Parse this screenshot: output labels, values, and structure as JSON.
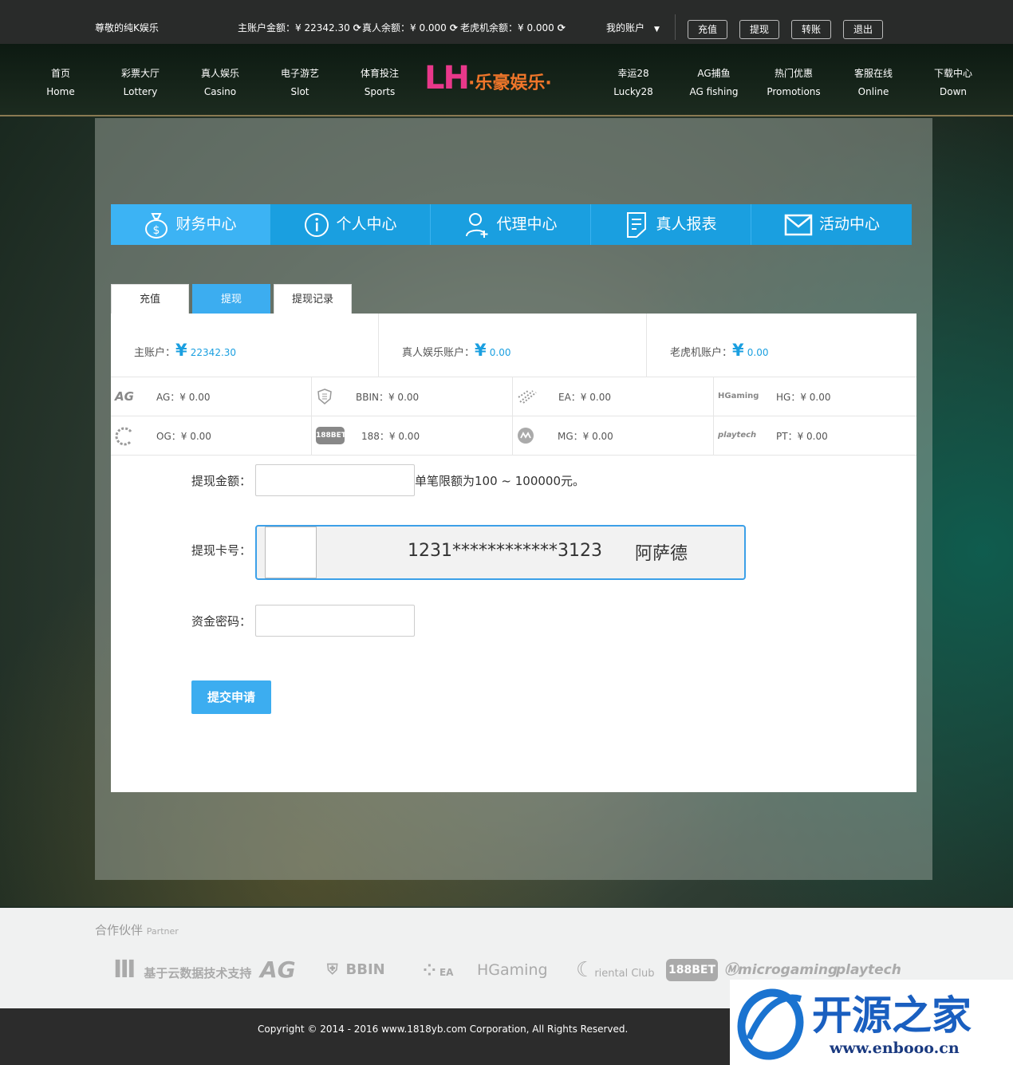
{
  "topbar": {
    "greeting": "尊敬的纯K娱乐",
    "main_balance": "主账户金额：¥ 22342.30",
    "live_balance": "真人余额：¥ 0.000",
    "slot_balance": "老虎机余额：¥ 0.000",
    "my_account": "我的账户",
    "buttons": [
      "充值",
      "提现",
      "转账",
      "退出"
    ]
  },
  "nav": {
    "left": [
      {
        "cn": "首页",
        "en": "Home"
      },
      {
        "cn": "彩票大厅",
        "en": "Lottery"
      },
      {
        "cn": "真人娱乐",
        "en": "Casino"
      },
      {
        "cn": "电子游艺",
        "en": "Slot"
      },
      {
        "cn": "体育投注",
        "en": "Sports"
      }
    ],
    "right": [
      {
        "cn": "幸运28",
        "en": "Lucky28"
      },
      {
        "cn": "AG捕鱼",
        "en": "AG fishing"
      },
      {
        "cn": "热门优惠",
        "en": "Promotions"
      },
      {
        "cn": "客服在线",
        "en": "Online"
      },
      {
        "cn": "下载中心",
        "en": "Down"
      }
    ],
    "logo_letters": "LH",
    "logo_text": "·乐豪娱乐·"
  },
  "center_tabs": [
    "财务中心",
    "个人中心",
    "代理中心",
    "真人报表",
    "活动中心"
  ],
  "sub_tabs": [
    "充值",
    "提现",
    "提现记录"
  ],
  "accounts": [
    {
      "label": "主账户：",
      "amount": "22342.30"
    },
    {
      "label": "真人娱乐账户：",
      "amount": "0.00"
    },
    {
      "label": "老虎机账户：",
      "amount": "0.00"
    }
  ],
  "yen_symbol": "¥",
  "games": [
    {
      "logo": "AG",
      "text": "AG：¥ 0.00"
    },
    {
      "logo": "",
      "text": "BBIN：¥ 0.00"
    },
    {
      "logo": "",
      "text": "EA：¥ 0.00"
    },
    {
      "logo": "HGaming",
      "text": "HG：¥ 0.00"
    },
    {
      "logo": "",
      "text": "OG：¥ 0.00"
    },
    {
      "logo": "188BET",
      "text": "188：¥ 0.00"
    },
    {
      "logo": "",
      "text": "MG：¥ 0.00"
    },
    {
      "logo": "playtech",
      "text": "PT：¥ 0.00"
    }
  ],
  "form": {
    "amount_label": "提现金额：",
    "amount_value": "",
    "amount_hint": "单笔限额为100 ~ 100000元。",
    "card_label": "提现卡号：",
    "card_number": "1231************3123",
    "card_holder": "阿萨德",
    "password_label": "资金密码：",
    "password_value": "",
    "submit": "提交申请"
  },
  "partner": {
    "title_cn": "合作伙伴",
    "title_en": "Partner",
    "logos": [
      "基于云数据技术支持",
      "AG",
      "BBIN",
      "EA",
      "HGaming",
      "riental Club",
      "188BET",
      "microgaming",
      "playtech"
    ]
  },
  "copyright": "Copyright © 2014 - 2016 www.1818yb.com Corporation, All Rights Reserved.",
  "watermark": {
    "title": "开源之家",
    "url": "www.enbooo.cn"
  },
  "colors": {
    "accent": "#1a9fe0",
    "tab_active": "#3cb3f4",
    "topbar": "#292b2a",
    "footer": "#2c2c2c"
  }
}
